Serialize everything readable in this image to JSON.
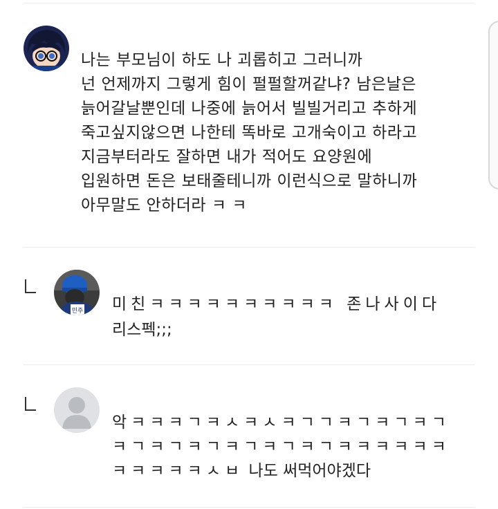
{
  "comments": [
    {
      "avatar": "anime-boy-avatar",
      "text": "나는 부모님이 하도 나 괴롭히고 그러니까\n넌 언제까지 그렇게 힘이 펄펄할꺼같냐? 남은날은\n늙어갈날뿐인데 나중에 늙어서 빌빌거리고 추하게\n죽고싶지않으면 나한테 똑바로 고개숙이고 하라고\n지금부터라도 잘하면 내가 적어도 요양원에\n입원하면 돈은 보태줄테니까 이런식으로 말하니까\n아무말도 안하더라 ㅋ ㅋ"
    }
  ],
  "replies": [
    {
      "avatar": "police-avatar",
      "lines": [
        "미친ㅋㅋㅋㅋㅋㅋㅋㅋㅋㅋ 존나사이다",
        "리스펙;;;"
      ]
    },
    {
      "avatar": "default-user-avatar",
      "lines": [
        "악ㅋㅋㅋㄱㅋㅅㅋㅅㅋㄱㄱㅋㄱㅋㄱㅋㄱ",
        "ㅋㄱㅋㄱㅋㄱㅋㄱㅋㄱㅋㄱㅋㅋㅋㅋㅋㅋ",
        "ㅋㅋㅋㅋㅋㅅㅂ 나도 써먹어야겠다"
      ]
    }
  ],
  "colors": {
    "divider": "#ebebeb",
    "text": "#222222",
    "default_avatar_bg": "#dfe1e4"
  }
}
